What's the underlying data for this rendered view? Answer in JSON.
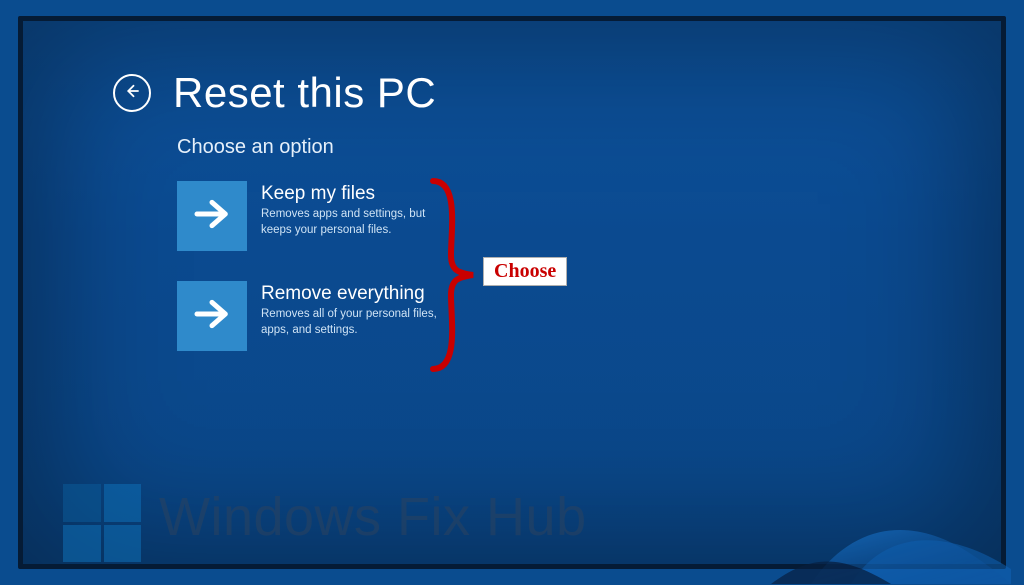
{
  "header": {
    "title": "Reset this PC",
    "back_icon": "back-arrow"
  },
  "subtitle": "Choose an option",
  "options": [
    {
      "title": "Keep my files",
      "description": "Removes apps and settings, but keeps your personal files."
    },
    {
      "title": "Remove everything",
      "description": "Removes all of your personal files, apps, and settings."
    }
  ],
  "annotation": {
    "label": "Choose"
  },
  "watermark": {
    "text": "Windows Fix Hub"
  },
  "colors": {
    "tile": "#2f8acb",
    "annotation": "#c90000"
  }
}
